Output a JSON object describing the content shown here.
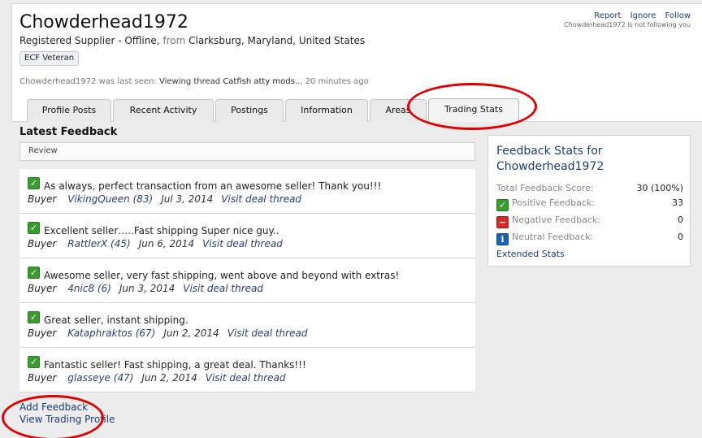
{
  "profile": {
    "username": "Chowderhead1972",
    "role_status": "Registered Supplier - Offline,",
    "from_label": "from",
    "location": "Clarksburg, Maryland, United States",
    "badge": "ECF Veteran",
    "last_seen_prefix": "Chowderhead1972 was last seen:",
    "last_seen_activity": "Viewing thread",
    "last_seen_thread": "Catfish atty mods..",
    "last_seen_time": ", 20 minutes ago"
  },
  "top_links": {
    "report": "Report",
    "ignore": "Ignore",
    "follow": "Follow",
    "not_following": "Chowderhead1972 is not following you"
  },
  "tabs": [
    {
      "label": "Profile Posts"
    },
    {
      "label": "Recent Activity"
    },
    {
      "label": "Postings"
    },
    {
      "label": "Information"
    },
    {
      "label": "Areas"
    },
    {
      "label": "Trading Stats",
      "active": true
    }
  ],
  "feedback": {
    "section_title": "Latest Feedback",
    "review_label": "Review",
    "items": [
      {
        "comment": "As always, perfect transaction from an awesome seller! Thank you!!!",
        "role": "Buyer",
        "user": "VikingQueen (83)",
        "date": "Jul 3, 2014",
        "link": "Visit deal thread"
      },
      {
        "comment": "Excellent seller…..Fast shipping Super nice guy..",
        "role": "Buyer",
        "user": "RattlerX (45)",
        "date": "Jun 6, 2014",
        "link": "Visit deal thread"
      },
      {
        "comment": "Awesome seller, very fast shipping, went above and beyond with extras!",
        "role": "Buyer",
        "user": "4nic8 (6)",
        "date": "Jun 3, 2014",
        "link": "Visit deal thread"
      },
      {
        "comment": "Great seller, instant shipping.",
        "role": "Buyer",
        "user": "Kataphraktos (67)",
        "date": "Jun 2, 2014",
        "link": "Visit deal thread"
      },
      {
        "comment": "Fantastic seller! Fast shipping, a great deal. Thanks!!!",
        "role": "Buyer",
        "user": "glasseye (47)",
        "date": "Jun 2, 2014",
        "link": "Visit deal thread"
      }
    ],
    "add_feedback": "Add Feedback",
    "view_trading_profile": "View Trading Profile"
  },
  "stats": {
    "title": "Feedback Stats for Chowderhead1972",
    "total_label": "Total Feedback Score:",
    "total_value": "30 (100%)",
    "positive_label": "Positive Feedback:",
    "positive_value": "33",
    "negative_label": "Negative Feedback:",
    "negative_value": "0",
    "neutral_label": "Neutral Feedback:",
    "neutral_value": "0",
    "extended": "Extended Stats"
  },
  "icons": {
    "positive": "check-icon",
    "negative": "minus-icon",
    "neutral": "info-icon"
  },
  "colors": {
    "link": "#1d3d73",
    "positive": "#3a9b2e",
    "negative": "#d02a2a",
    "neutral": "#1f5fb2",
    "annotation": "#e00000"
  }
}
